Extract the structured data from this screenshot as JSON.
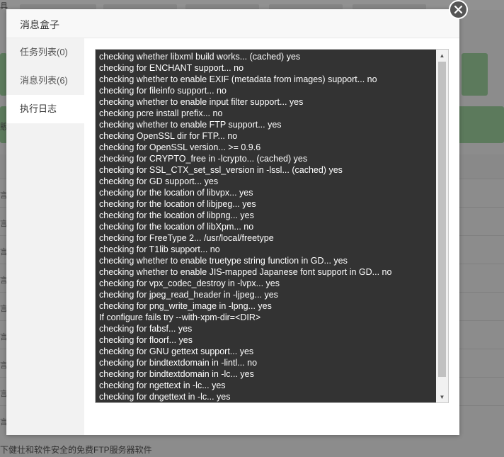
{
  "background": {
    "top_label": "具",
    "side_label": "販",
    "row_label": "言",
    "footer_text": "下健壮和软件安全的免费FTP服务器软件"
  },
  "modal": {
    "title": "消息盒子",
    "close_icon": "close-icon"
  },
  "sidebar": {
    "items": [
      {
        "label": "任务列表(0)",
        "active": false
      },
      {
        "label": "消息列表(6)",
        "active": false
      },
      {
        "label": "执行日志",
        "active": true
      }
    ]
  },
  "log": {
    "lines": [
      "checking whether libxml build works... (cached) yes",
      "checking for ENCHANT support... no",
      "checking whether to enable EXIF (metadata from images) support... no",
      "checking for fileinfo support... no",
      "checking whether to enable input filter support... yes",
      "checking pcre install prefix... no",
      "checking whether to enable FTP support... yes",
      "checking OpenSSL dir for FTP... no",
      "checking for OpenSSL version... >= 0.9.6",
      "checking for CRYPTO_free in -lcrypto... (cached) yes",
      "checking for SSL_CTX_set_ssl_version in -lssl... (cached) yes",
      "checking for GD support... yes",
      "checking for the location of libvpx... yes",
      "checking for the location of libjpeg... yes",
      "checking for the location of libpng... yes",
      "checking for the location of libXpm... no",
      "checking for FreeType 2... /usr/local/freetype",
      "checking for T1lib support... no",
      "checking whether to enable truetype string function in GD... yes",
      "checking whether to enable JIS-mapped Japanese font support in GD... no",
      "checking for vpx_codec_destroy in -lvpx... yes",
      "checking for jpeg_read_header in -ljpeg... yes",
      "checking for png_write_image in -lpng... yes",
      "If configure fails try --with-xpm-dir=<DIR>",
      "checking for fabsf... yes",
      "checking for floorf... yes",
      "checking for GNU gettext support... yes",
      "checking for bindtextdomain in -lintl... no",
      "checking for bindtextdomain in -lc... yes",
      "checking for ngettext in -lc... yes",
      "checking for dngettext in -lc... yes"
    ]
  }
}
